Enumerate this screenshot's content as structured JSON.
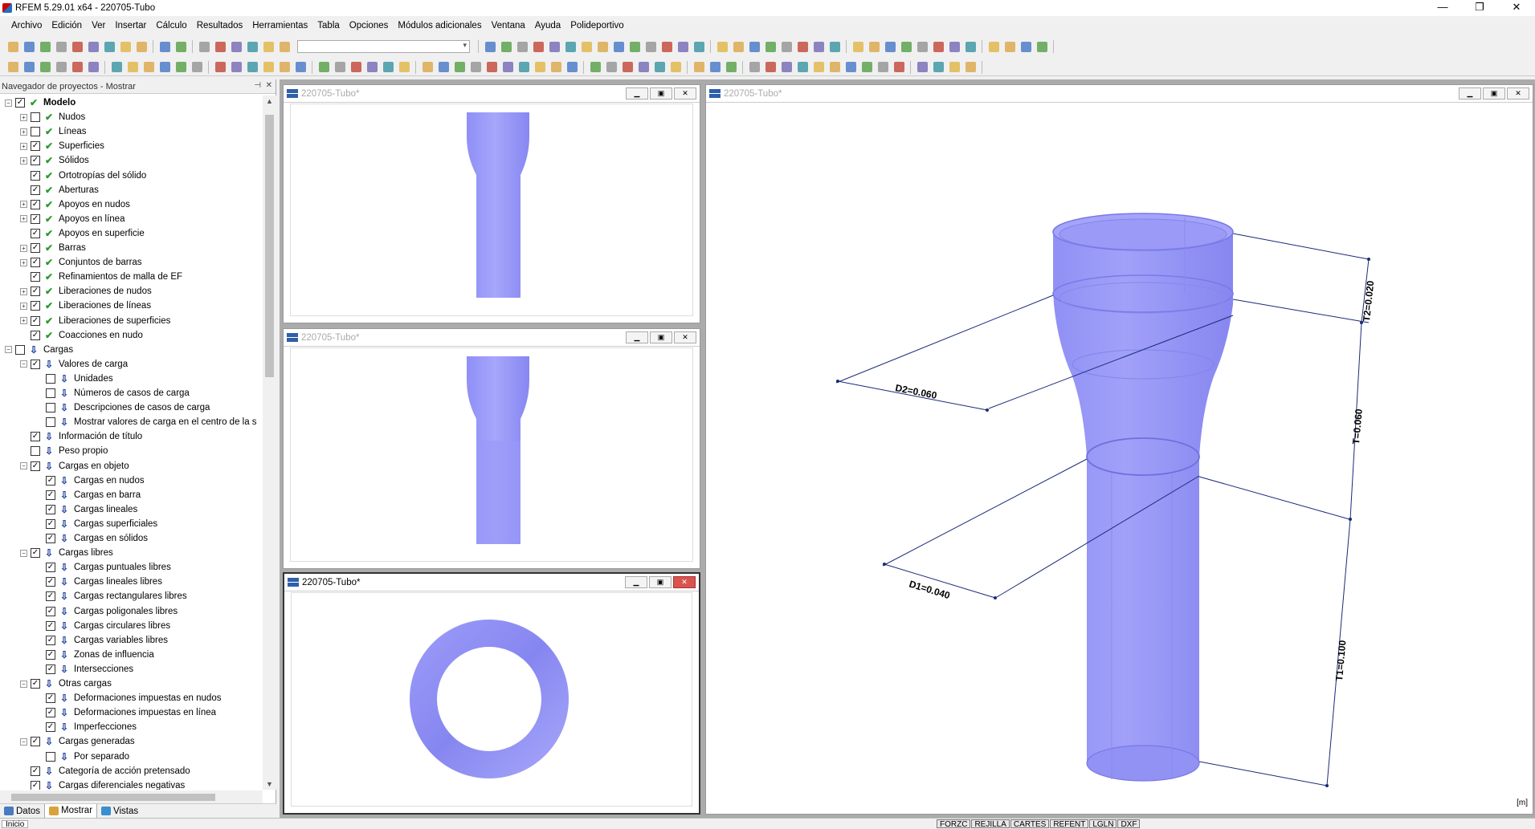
{
  "app": {
    "title": "RFEM 5.29.01 x64 - 220705-Tubo"
  },
  "menu": [
    "Archivo",
    "Edición",
    "Ver",
    "Insertar",
    "Cálculo",
    "Resultados",
    "Herramientas",
    "Tabla",
    "Opciones",
    "Módulos adicionales",
    "Ventana",
    "Ayuda",
    "Polideportivo"
  ],
  "navigator": {
    "title": "Navegador de proyectos - Mostrar",
    "items": [
      {
        "label": "Modelo",
        "level": 0,
        "exp": "−",
        "chk": "✓",
        "icon": "model",
        "bold": true
      },
      {
        "label": "Nudos",
        "level": 1,
        "exp": "+",
        "chk": "",
        "icon": "model"
      },
      {
        "label": "Líneas",
        "level": 1,
        "exp": "+",
        "chk": "",
        "icon": "model"
      },
      {
        "label": "Superficies",
        "level": 1,
        "exp": "+",
        "chk": "✓",
        "icon": "model"
      },
      {
        "label": "Sólidos",
        "level": 1,
        "exp": "+",
        "chk": "✓",
        "icon": "model"
      },
      {
        "label": "Ortotropías del sólido",
        "level": 1,
        "exp": "",
        "chk": "✓",
        "icon": "model"
      },
      {
        "label": "Aberturas",
        "level": 1,
        "exp": "",
        "chk": "✓",
        "icon": "model"
      },
      {
        "label": "Apoyos en nudos",
        "level": 1,
        "exp": "+",
        "chk": "✓",
        "icon": "model"
      },
      {
        "label": "Apoyos en línea",
        "level": 1,
        "exp": "+",
        "chk": "✓",
        "icon": "model"
      },
      {
        "label": "Apoyos en superficie",
        "level": 1,
        "exp": "",
        "chk": "✓",
        "icon": "model"
      },
      {
        "label": "Barras",
        "level": 1,
        "exp": "+",
        "chk": "✓",
        "icon": "model"
      },
      {
        "label": "Conjuntos de barras",
        "level": 1,
        "exp": "+",
        "chk": "✓",
        "icon": "model"
      },
      {
        "label": "Refinamientos de malla de EF",
        "level": 1,
        "exp": "",
        "chk": "✓",
        "icon": "model"
      },
      {
        "label": "Liberaciones de nudos",
        "level": 1,
        "exp": "+",
        "chk": "✓",
        "icon": "model"
      },
      {
        "label": "Liberaciones de líneas",
        "level": 1,
        "exp": "+",
        "chk": "✓",
        "icon": "model"
      },
      {
        "label": "Liberaciones de superficies",
        "level": 1,
        "exp": "+",
        "chk": "✓",
        "icon": "model"
      },
      {
        "label": "Coacciones en nudo",
        "level": 1,
        "exp": "",
        "chk": "✓",
        "icon": "model"
      },
      {
        "label": "Cargas",
        "level": 0,
        "exp": "−",
        "chk": "",
        "icon": "load"
      },
      {
        "label": "Valores de carga",
        "level": 1,
        "exp": "−",
        "chk": "✓",
        "icon": "load"
      },
      {
        "label": "Unidades",
        "level": 2,
        "exp": "",
        "chk": "",
        "icon": "load"
      },
      {
        "label": "Números de casos de carga",
        "level": 2,
        "exp": "",
        "chk": "",
        "icon": "load"
      },
      {
        "label": "Descripciones de casos de carga",
        "level": 2,
        "exp": "",
        "chk": "",
        "icon": "load"
      },
      {
        "label": "Mostrar valores de carga en el centro de la s",
        "level": 2,
        "exp": "",
        "chk": "",
        "icon": "load"
      },
      {
        "label": "Información de título",
        "level": 1,
        "exp": "",
        "chk": "✓",
        "icon": "load"
      },
      {
        "label": "Peso propio",
        "level": 1,
        "exp": "",
        "chk": "",
        "icon": "load"
      },
      {
        "label": "Cargas en objeto",
        "level": 1,
        "exp": "−",
        "chk": "✓",
        "icon": "load"
      },
      {
        "label": "Cargas en nudos",
        "level": 2,
        "exp": "",
        "chk": "✓",
        "icon": "load"
      },
      {
        "label": "Cargas en barra",
        "level": 2,
        "exp": "",
        "chk": "✓",
        "icon": "load"
      },
      {
        "label": "Cargas lineales",
        "level": 2,
        "exp": "",
        "chk": "✓",
        "icon": "load"
      },
      {
        "label": "Cargas superficiales",
        "level": 2,
        "exp": "",
        "chk": "✓",
        "icon": "load"
      },
      {
        "label": "Cargas en sólidos",
        "level": 2,
        "exp": "",
        "chk": "✓",
        "icon": "load"
      },
      {
        "label": "Cargas libres",
        "level": 1,
        "exp": "−",
        "chk": "✓",
        "icon": "load"
      },
      {
        "label": "Cargas puntuales libres",
        "level": 2,
        "exp": "",
        "chk": "✓",
        "icon": "load"
      },
      {
        "label": "Cargas lineales libres",
        "level": 2,
        "exp": "",
        "chk": "✓",
        "icon": "load"
      },
      {
        "label": "Cargas rectangulares libres",
        "level": 2,
        "exp": "",
        "chk": "✓",
        "icon": "load"
      },
      {
        "label": "Cargas poligonales libres",
        "level": 2,
        "exp": "",
        "chk": "✓",
        "icon": "load"
      },
      {
        "label": "Cargas circulares libres",
        "level": 2,
        "exp": "",
        "chk": "✓",
        "icon": "load"
      },
      {
        "label": "Cargas variables libres",
        "level": 2,
        "exp": "",
        "chk": "✓",
        "icon": "load"
      },
      {
        "label": "Zonas de influencia",
        "level": 2,
        "exp": "",
        "chk": "✓",
        "icon": "load"
      },
      {
        "label": "Intersecciones",
        "level": 2,
        "exp": "",
        "chk": "✓",
        "icon": "load"
      },
      {
        "label": "Otras cargas",
        "level": 1,
        "exp": "−",
        "chk": "✓",
        "icon": "load"
      },
      {
        "label": "Deformaciones impuestas en nudos",
        "level": 2,
        "exp": "",
        "chk": "✓",
        "icon": "load"
      },
      {
        "label": "Deformaciones impuestas en línea",
        "level": 2,
        "exp": "",
        "chk": "✓",
        "icon": "load"
      },
      {
        "label": "Imperfecciones",
        "level": 2,
        "exp": "",
        "chk": "✓",
        "icon": "load"
      },
      {
        "label": "Cargas generadas",
        "level": 1,
        "exp": "−",
        "chk": "✓",
        "icon": "load"
      },
      {
        "label": "Por separado",
        "level": 2,
        "exp": "",
        "chk": "",
        "icon": "load"
      },
      {
        "label": "Categoría de acción pretensado",
        "level": 1,
        "exp": "",
        "chk": "✓",
        "icon": "load"
      },
      {
        "label": "Cargas diferenciales negativas",
        "level": 1,
        "exp": "",
        "chk": "✓",
        "icon": "load"
      }
    ],
    "tabs": [
      "Datos",
      "Mostrar",
      "Vistas"
    ],
    "active_tab": "Mostrar"
  },
  "windows": {
    "view1": {
      "title": "220705-Tubo*"
    },
    "view2": {
      "title": "220705-Tubo*"
    },
    "view3": {
      "title": "220705-Tubo*"
    },
    "view3d": {
      "title": "220705-Tubo*"
    }
  },
  "dimensions": {
    "d1": "D1=0.040",
    "d2": "D2=0.060",
    "t1": "T1=0.100",
    "t2": "T2=0.020",
    "t": "T=0.060",
    "unit": "[m]"
  },
  "status": {
    "inicio": "Inicio",
    "flags": [
      "FORZC",
      "REJILLA",
      "CARTES",
      "REFENT",
      "LGLN",
      "DXF"
    ]
  },
  "colors": {
    "tube": "#8a8af5",
    "tube_light": "#a9a9fb",
    "dim": "#1a2a7a"
  }
}
